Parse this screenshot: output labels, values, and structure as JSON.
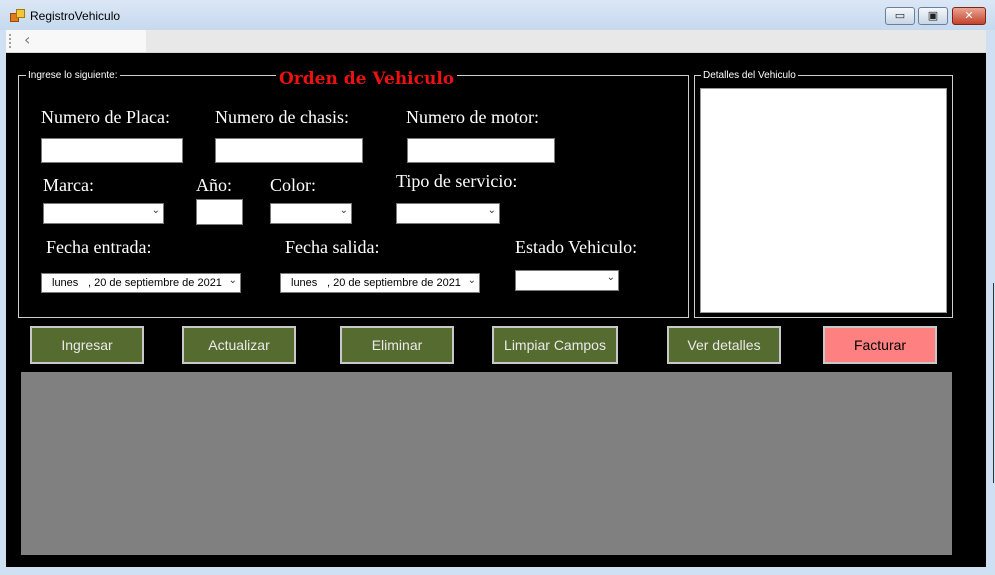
{
  "window": {
    "title": "RegistroVehiculo",
    "minimize_glyph": "▭",
    "maximize_glyph": "▣",
    "close_glyph": "✕",
    "back_glyph": "‹"
  },
  "form": {
    "group_legend": "Ingrese lo siguiente:",
    "order_title": "Orden de Vehiculo",
    "labels": {
      "placa": "Numero de Placa:",
      "chasis": "Numero de chasis:",
      "motor": "Numero de motor:",
      "marca": "Marca:",
      "anio": "Año:",
      "color": "Color:",
      "tipo_servicio": "Tipo de servicio:",
      "fecha_entrada": "Fecha entrada:",
      "fecha_salida": "Fecha salida:",
      "estado": "Estado Vehiculo:"
    },
    "values": {
      "placa": "",
      "chasis": "",
      "motor": "",
      "anio": "",
      "marca": "",
      "color": "",
      "tipo_servicio": "",
      "estado": "",
      "fecha_entrada_day": "lunes",
      "fecha_entrada_date": ", 20 de septiembre de 2021",
      "fecha_salida_day": "lunes",
      "fecha_salida_date": ", 20 de septiembre de 2021"
    },
    "dropdown_arrow": "⌄"
  },
  "details": {
    "legend": "Detalles del Vehiculo",
    "text": ""
  },
  "buttons": {
    "ingresar": "Ingresar",
    "actualizar": "Actualizar",
    "eliminar": "Eliminar",
    "limpiar": "Limpiar Campos",
    "ver_detalles": "Ver detalles",
    "facturar": "Facturar"
  },
  "colors": {
    "form_background": "#000000",
    "title_red": "#ee1111",
    "button_green": "#556b2f",
    "button_red": "#ff8080",
    "grid_gray": "#808080"
  }
}
